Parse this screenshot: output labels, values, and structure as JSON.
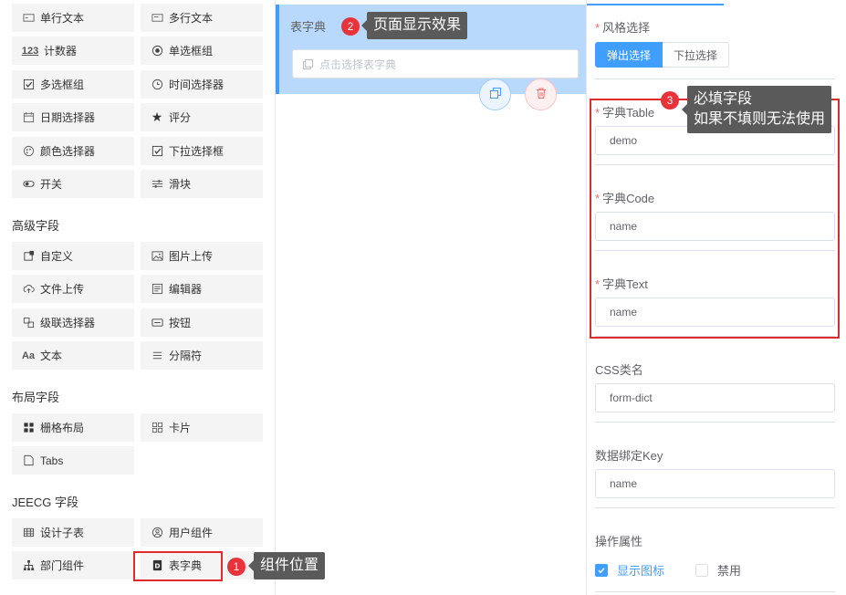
{
  "palette": {
    "basic_items": [
      {
        "label": "单行文本",
        "icon": "input-icon"
      },
      {
        "label": "多行文本",
        "icon": "textarea-icon"
      },
      {
        "label": "计数器",
        "icon": "counter-icon"
      },
      {
        "label": "单选框组",
        "icon": "radio-icon"
      },
      {
        "label": "多选框组",
        "icon": "checkbox-icon"
      },
      {
        "label": "时间选择器",
        "icon": "clock-icon"
      },
      {
        "label": "日期选择器",
        "icon": "calendar-icon"
      },
      {
        "label": "评分",
        "icon": "star-icon"
      },
      {
        "label": "颜色选择器",
        "icon": "palette-icon"
      },
      {
        "label": "下拉选择框",
        "icon": "select-icon"
      },
      {
        "label": "开关",
        "icon": "switch-icon"
      },
      {
        "label": "滑块",
        "icon": "slider-icon"
      }
    ],
    "advanced_title": "高级字段",
    "advanced_items": [
      {
        "label": "自定义",
        "icon": "custom-icon"
      },
      {
        "label": "图片上传",
        "icon": "image-icon"
      },
      {
        "label": "文件上传",
        "icon": "upload-icon"
      },
      {
        "label": "编辑器",
        "icon": "editor-icon"
      },
      {
        "label": "级联选择器",
        "icon": "cascader-icon"
      },
      {
        "label": "按钮",
        "icon": "button-icon"
      },
      {
        "label": "文本",
        "icon": "text-icon"
      },
      {
        "label": "分隔符",
        "icon": "divider-icon"
      }
    ],
    "layout_title": "布局字段",
    "layout_items": [
      {
        "label": "栅格布局",
        "icon": "grid-icon"
      },
      {
        "label": "卡片",
        "icon": "card-icon"
      },
      {
        "label": "Tabs",
        "icon": "tabs-icon"
      }
    ],
    "jeecg_title": "JEECG 字段",
    "jeecg_items": [
      {
        "label": "设计子表",
        "icon": "table-icon"
      },
      {
        "label": "用户组件",
        "icon": "user-icon"
      },
      {
        "label": "部门组件",
        "icon": "org-icon"
      },
      {
        "label": "表字典",
        "icon": "dict-icon"
      }
    ]
  },
  "canvas": {
    "selected_label": "表字典",
    "input_placeholder": "点击选择表字典"
  },
  "props": {
    "style_label": "风格选择",
    "style_options": [
      "弹出选择",
      "下拉选择"
    ],
    "dict_table_label": "字典Table",
    "dict_table_value": "demo",
    "dict_code_label": "字典Code",
    "dict_code_value": "name",
    "dict_text_label": "字典Text",
    "dict_text_value": "name",
    "css_label": "CSS类名",
    "css_value": "form-dict",
    "bind_key_label": "数据绑定Key",
    "bind_key_value": "name",
    "ops_label": "操作属性",
    "show_icon_label": "显示图标",
    "disabled_label": "禁用",
    "required_mark": "*"
  },
  "annotations": {
    "one": {
      "num": "1",
      "text": "组件位置"
    },
    "two": {
      "num": "2",
      "text": "页面显示效果"
    },
    "three": {
      "num": "3",
      "line1": "必填字段",
      "line2": "如果不填则无法使用"
    }
  },
  "colors": {
    "accent": "#409eff",
    "annotation_red": "#e02b2b",
    "tooltip_bg": "#5a5a5a"
  }
}
